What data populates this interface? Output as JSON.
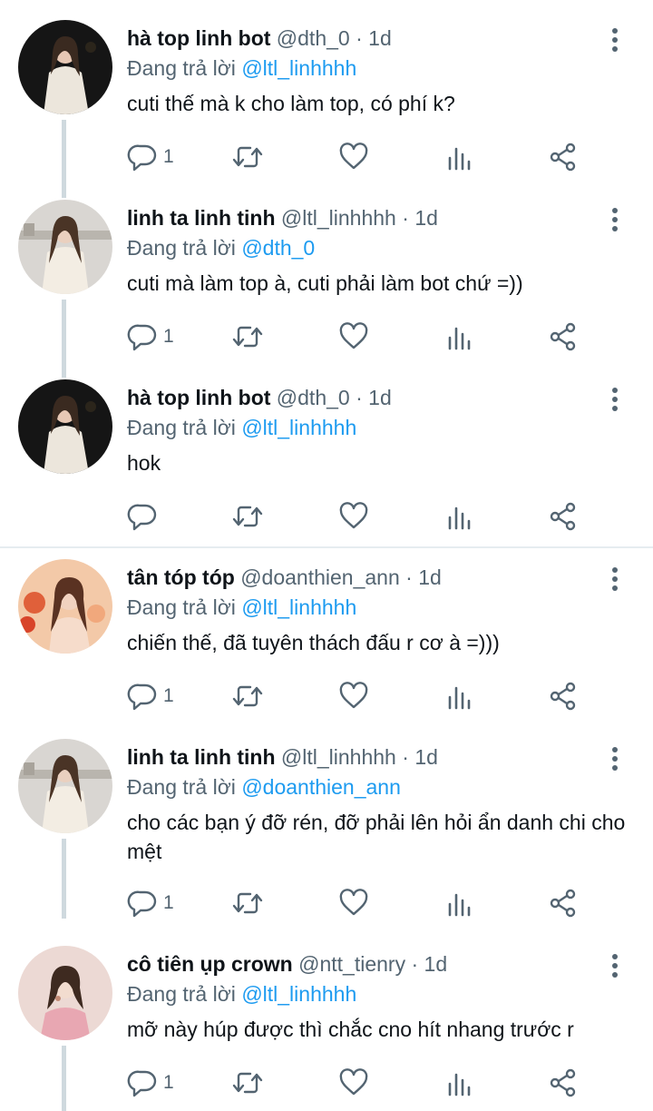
{
  "reply_prefix": "Đang trả lời",
  "separator": "·",
  "tweets": [
    {
      "display_name": "hà top linh bot",
      "handle": "@dth_0",
      "time": "1d",
      "reply_to": "@ltl_linhhhh",
      "text": "cuti thế mà k cho làm top, có phí k?",
      "reply_count": "1",
      "avatar": "dark-night"
    },
    {
      "display_name": "linh ta linh tinh",
      "handle": "@ltl_linhhhh",
      "time": "1d",
      "reply_to": "@dth_0",
      "text": "cuti mà làm top à, cuti phải làm bot chứ =))",
      "reply_count": "1",
      "avatar": "city-day"
    },
    {
      "display_name": "hà top linh bot",
      "handle": "@dth_0",
      "time": "1d",
      "reply_to": "@ltl_linhhhh",
      "text": "hok",
      "reply_count": "",
      "avatar": "dark-night"
    },
    {
      "display_name": "tân tóp tóp",
      "handle": "@doanthien_ann",
      "time": "1d",
      "reply_to": "@ltl_linhhhh",
      "text": "chiến thế, đã tuyên thách đấu r cơ à =)))",
      "reply_count": "1",
      "avatar": "flowers-warm"
    },
    {
      "display_name": "linh ta linh tinh",
      "handle": "@ltl_linhhhh",
      "time": "1d",
      "reply_to": "@doanthien_ann",
      "text": "cho các bạn ý đỡ rén, đỡ phải lên hỏi ẩn danh chi cho mệt",
      "reply_count": "1",
      "avatar": "city-day"
    },
    {
      "display_name": "cô tiên ụp crown",
      "handle": "@ntt_tienry",
      "time": "1d",
      "reply_to": "@ltl_linhhhh",
      "text": "mỡ này húp được thì chắc cno hít nhang trước r",
      "reply_count": "1",
      "avatar": "pink-studio"
    }
  ],
  "icons": {
    "more": "more-vertical-icon",
    "reply": "reply-icon",
    "retweet": "retweet-icon",
    "like": "heart-icon",
    "views": "views-icon",
    "share": "share-icon"
  },
  "colors": {
    "text_primary": "#0f1419",
    "text_secondary": "#536471",
    "mention": "#1d9bf0",
    "thread_line": "#cfd9de"
  }
}
